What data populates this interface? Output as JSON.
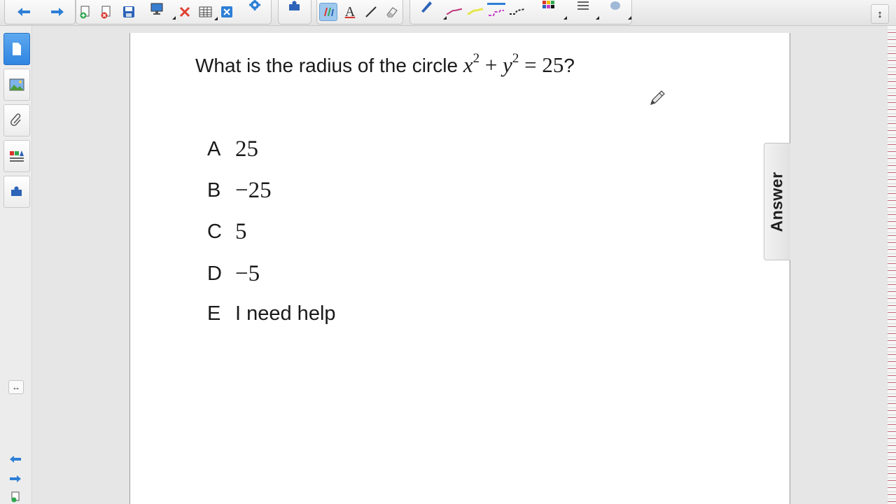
{
  "toolbar": {
    "icons": [
      "back-arrow-icon",
      "forward-arrow-icon",
      "add-page-icon",
      "delete-page-icon",
      "save-icon",
      "screen-icon",
      "delete-icon",
      "table-icon",
      "close-box-icon",
      "gear-icon",
      "puzzle-icon",
      "pen-icon",
      "text-icon",
      "line-icon",
      "eraser-icon",
      "creative-pen-icon",
      "color-palette-icon",
      "line-style-icon",
      "fill-icon"
    ],
    "text_tool_glyph": "A",
    "accent": "#2d7fd6"
  },
  "question": {
    "prefix": "What is the radius of the circle ",
    "var1": "x",
    "exp1": "2",
    "plus": " + ",
    "var2": "y",
    "exp2": "2",
    "equals": " = 25",
    "suffix": "?"
  },
  "choices": [
    {
      "letter": "A",
      "value": "25"
    },
    {
      "letter": "B",
      "value": "−25"
    },
    {
      "letter": "C",
      "value": "5"
    },
    {
      "letter": "D",
      "value": "−5"
    },
    {
      "letter": "E",
      "value": "I need help"
    }
  ],
  "answer_tab": {
    "label": "Answer"
  },
  "sidebar": {
    "tabs": [
      "page-sorter-icon",
      "gallery-icon",
      "attachments-icon",
      "properties-icon",
      "addons-icon"
    ],
    "resize_glyph": "↔"
  }
}
